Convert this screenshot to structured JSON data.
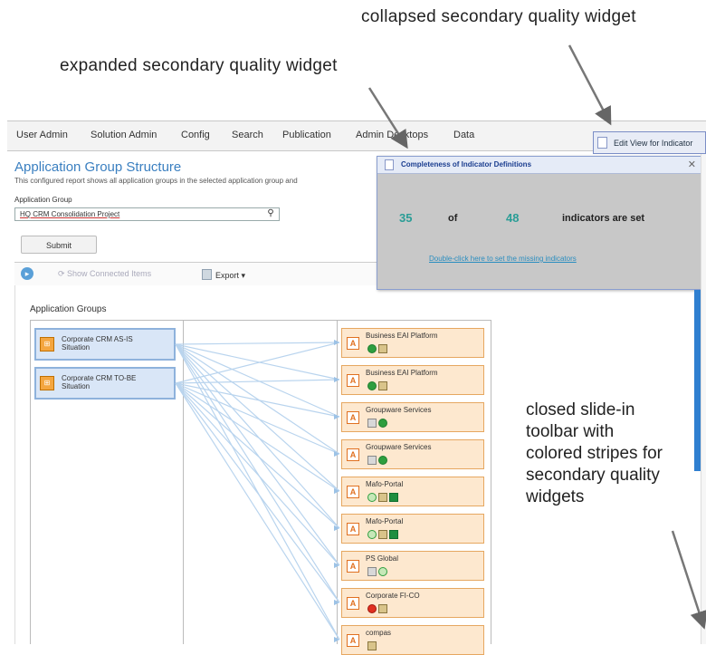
{
  "annotations": {
    "collapsed": "collapsed secondary quality widget",
    "expanded": "expanded secondary quality widget",
    "slide_in": [
      "closed slide-in",
      "toolbar with",
      "colored stripes for",
      "secondary quality",
      "widgets"
    ]
  },
  "menu": [
    "User Admin",
    "Solution Admin",
    "Config",
    "Search",
    "Publication",
    "Admin Desktops",
    "Data"
  ],
  "edit_view_label": "Edit View for Indicator",
  "page": {
    "title": "Application Group Structure",
    "description": "This configured report shows all application groups in the selected application group and"
  },
  "app_group_field": {
    "label": "Application Group",
    "value": "HQ CRM Consolidation Project"
  },
  "submit_label": "Submit",
  "toolbar": {
    "show_connected": "Show Connected Items",
    "export": "Export"
  },
  "section_title": "Application Groups",
  "groups": [
    {
      "line1": "Corporate CRM AS-IS",
      "line2": "Situation"
    },
    {
      "line1": "Corporate CRM TO-BE",
      "line2": "Situation"
    }
  ],
  "items": [
    {
      "label": "Business EAI Platform",
      "indicators": [
        "g",
        "sq"
      ]
    },
    {
      "label": "Business EAI Platform",
      "indicators": [
        "g",
        "sq"
      ]
    },
    {
      "label": "Groupware Services",
      "indicators": [
        "grey",
        "g"
      ]
    },
    {
      "label": "Groupware Services",
      "indicators": [
        "grey",
        "g"
      ]
    },
    {
      "label": "Mafo-Portal",
      "indicators": [
        "lg",
        "sq",
        "gsq"
      ]
    },
    {
      "label": "Mafo-Portal",
      "indicators": [
        "lg",
        "sq",
        "gsq"
      ]
    },
    {
      "label": "PS Global",
      "indicators": [
        "grey",
        "lg"
      ]
    },
    {
      "label": "Corporate FI-CO",
      "indicators": [
        "r",
        "sq"
      ]
    },
    {
      "label": "compas",
      "indicators": [
        "sq"
      ]
    }
  ],
  "popup": {
    "title": "Completeness of Indicator Definitions",
    "set_count": "35",
    "of_text": "of",
    "total_count": "48",
    "suffix": "indicators are set",
    "link": "Double-click here to set the missing indicators"
  },
  "colors": {
    "accent": "#3a7fc0",
    "item_bg": "#fde8cf",
    "group_bg": "#d9e6f7",
    "stripe": "#2f7fd0",
    "count": "#2a9d96"
  }
}
